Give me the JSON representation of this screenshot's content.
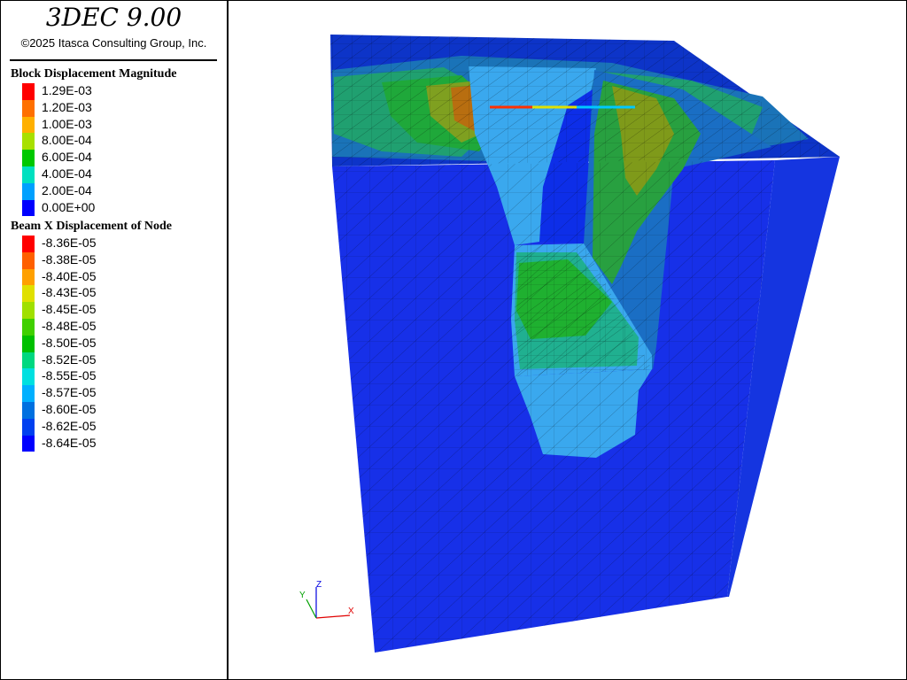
{
  "app": {
    "title": "3DEC 9.00",
    "copyright": "©2025 Itasca Consulting Group, Inc."
  },
  "legend_block": {
    "title": "Block  Displacement Magnitude",
    "entries": [
      {
        "label": "1.29E-03",
        "color": "#ff0000"
      },
      {
        "label": "1.20E-03",
        "color": "#ff7000"
      },
      {
        "label": "1.00E-03",
        "color": "#ffb000"
      },
      {
        "label": "8.00E-04",
        "color": "#a8e000"
      },
      {
        "label": "6.00E-04",
        "color": "#00c800"
      },
      {
        "label": "4.00E-04",
        "color": "#00e0c0"
      },
      {
        "label": "2.00E-04",
        "color": "#00a0ff"
      },
      {
        "label": "0.00E+00",
        "color": "#0000ff"
      }
    ]
  },
  "legend_beam": {
    "title": "Beam X Displacement of Node",
    "entries": [
      {
        "label": "-8.36E-05",
        "color": "#ff0000"
      },
      {
        "label": "-8.38E-05",
        "color": "#ff6000"
      },
      {
        "label": "-8.40E-05",
        "color": "#ffa000"
      },
      {
        "label": "-8.43E-05",
        "color": "#e0e000"
      },
      {
        "label": "-8.45E-05",
        "color": "#a0e000"
      },
      {
        "label": "-8.48E-05",
        "color": "#40d000"
      },
      {
        "label": "-8.50E-05",
        "color": "#00c000"
      },
      {
        "label": "-8.52E-05",
        "color": "#00d880"
      },
      {
        "label": "-8.55E-05",
        "color": "#00e0e0"
      },
      {
        "label": "-8.57E-05",
        "color": "#00b0ff"
      },
      {
        "label": "-8.60E-05",
        "color": "#0070e0"
      },
      {
        "label": "-8.62E-05",
        "color": "#0040f0"
      },
      {
        "label": "-8.64E-05",
        "color": "#0000ff"
      }
    ]
  },
  "axes_triad": {
    "x": "X",
    "y": "Y",
    "z": "Z"
  }
}
